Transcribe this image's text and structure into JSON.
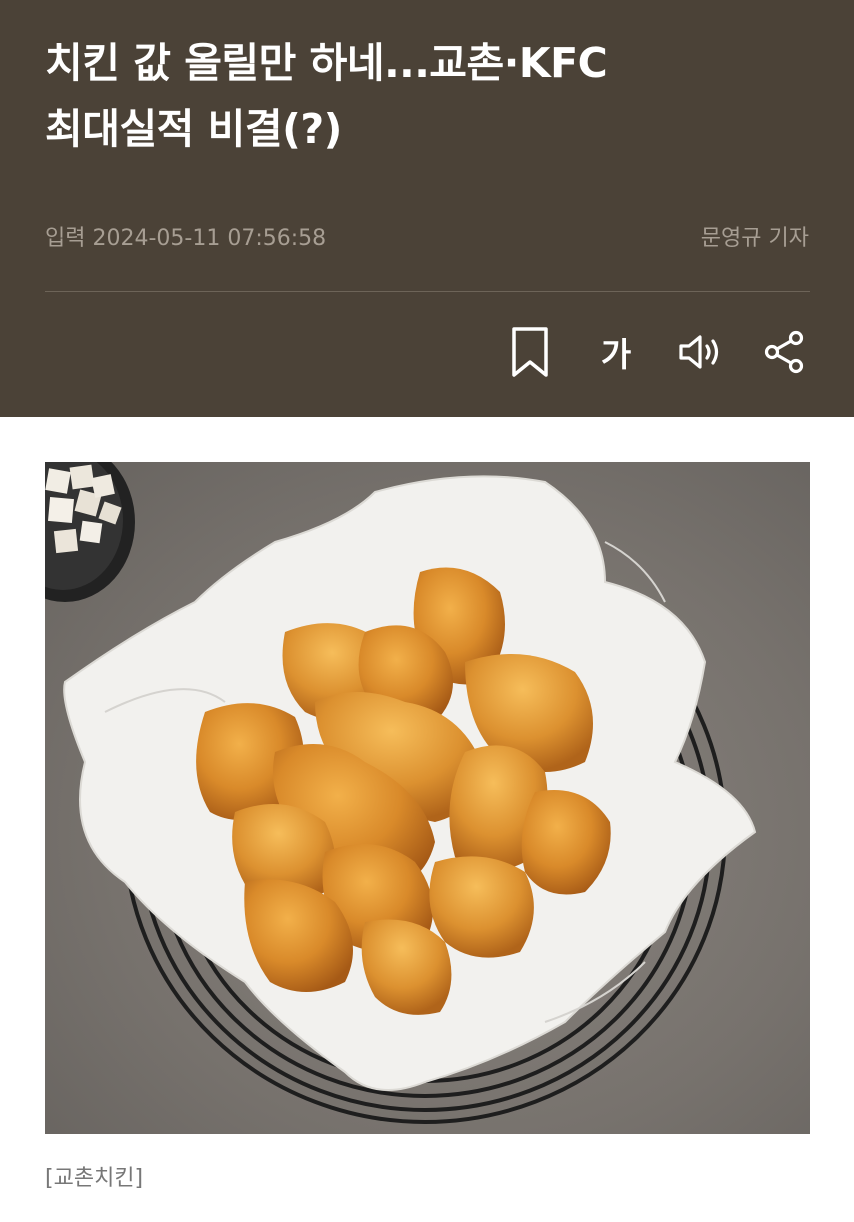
{
  "article": {
    "title_line1": "치킨 값 올릴만 하네...교촌·KFC",
    "title_line2": "최대실적 비결(?)",
    "date": "입력 2024-05-11 07:56:58",
    "reporter": "문영규 기자"
  },
  "toolbar": {
    "bookmark_icon": "bookmark-icon",
    "font_size_label": "가",
    "audio_icon": "speaker-icon",
    "share_icon": "share-icon"
  },
  "photo": {
    "subject": "fried-chicken-basket",
    "caption": "[교촌치킨]"
  },
  "colors": {
    "header_bg": "#4b4237",
    "meta_text": "#a79e93",
    "caption_text": "#777777"
  }
}
